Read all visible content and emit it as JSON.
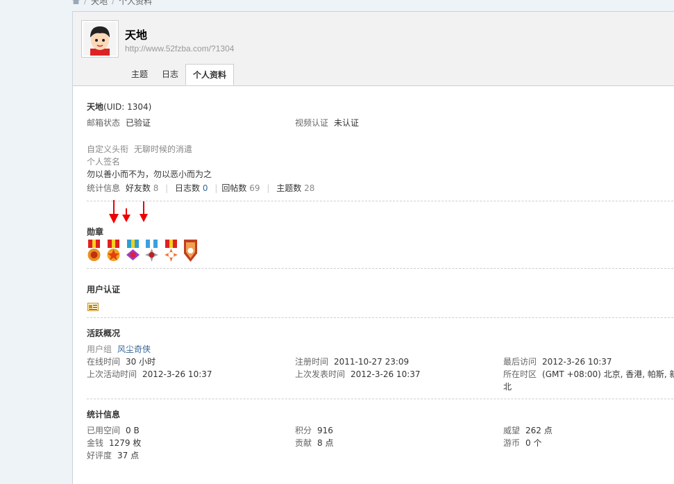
{
  "breadcrumb": {
    "home_icon": "home-icon",
    "items": [
      "天地",
      "个人资料"
    ]
  },
  "header": {
    "username": "天地",
    "profile_url": "http://www.52fzba.com/?1304",
    "avatar_icon": "cartoon-avatar-icon",
    "tabs": [
      {
        "label": "主题",
        "active": false
      },
      {
        "label": "日志",
        "active": false
      },
      {
        "label": "个人资料",
        "active": true
      }
    ]
  },
  "profile": {
    "name": "天地",
    "uid_text": "(UID: 1304)",
    "email_label": "邮箱状态",
    "email_value": "已验证",
    "video_label": "视频认证",
    "video_value": "未认证",
    "title_label": "自定义头衔",
    "title_value": "无聊时候的消遣",
    "signature_label": "个人签名",
    "signature_value": "勿以善小而不为，勿以恶小而为之",
    "stats_label": "统计信息",
    "friends_label": "好友数",
    "friends_value": "8",
    "blogs_label": "日志数",
    "blogs_value": "0",
    "replies_label": "回帖数",
    "replies_value": "69",
    "threads_label": "主题数",
    "threads_value": "28"
  },
  "medals": {
    "title": "勋章",
    "items": [
      "medal-icon-1",
      "medal-icon-2",
      "medal-icon-3",
      "medal-icon-4",
      "medal-icon-5",
      "medal-icon-6"
    ]
  },
  "certification": {
    "title": "用户认证",
    "icon": "id-card-icon"
  },
  "activity": {
    "title": "活跃概况",
    "group_label": "用户组",
    "group_value": "风尘奇侠",
    "online_label": "在线时间",
    "online_value": "30 小时",
    "reg_label": "注册时间",
    "reg_value": "2011-10-27 23:09",
    "last_visit_label": "最后访问",
    "last_visit_value": "2012-3-26 10:37",
    "last_active_label": "上次活动时间",
    "last_active_value": "2012-3-26 10:37",
    "last_post_label": "上次发表时间",
    "last_post_value": "2012-3-26 10:37",
    "tz_label": "所在时区",
    "tz_value": "(GMT +08:00) 北京, 香港, 帕斯, 新",
    "tz_value2": "北"
  },
  "statistics": {
    "title": "统计信息",
    "space_label": "已用空间",
    "space_value": "0 B",
    "points_label": "积分",
    "points_value": "916",
    "prestige_label": "威望",
    "prestige_value": "262 点",
    "money_label": "金钱",
    "money_value": "1279 枚",
    "contrib_label": "贡献",
    "contrib_value": "8 点",
    "coin_label": "游币",
    "coin_value": "0 个",
    "rating_label": "好评度",
    "rating_value": "37 点"
  },
  "colors": {
    "link": "#336699",
    "arrow": "#ee0000",
    "border": "#cdcdcd"
  }
}
